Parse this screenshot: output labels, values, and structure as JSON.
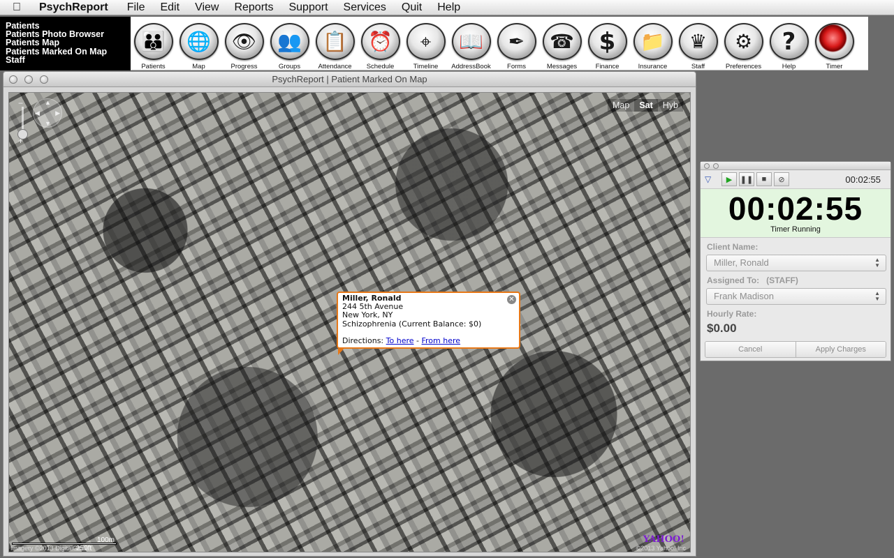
{
  "menubar": {
    "apple": "",
    "app_name": "PsychReport",
    "items": [
      "File",
      "Edit",
      "View",
      "Reports",
      "Support",
      "Services",
      "Quit",
      "Help"
    ]
  },
  "leftnav": {
    "items": [
      "Patients",
      "Patients Photo Browser",
      "Patients Map",
      "Patients Marked On Map",
      "Staff"
    ]
  },
  "toolbar": {
    "tools": [
      {
        "label": "Patients",
        "icon": "people-icon",
        "glyph": "👪"
      },
      {
        "label": "Map",
        "icon": "globe-icon",
        "glyph": "🌐"
      },
      {
        "label": "Progress",
        "icon": "eye-icon",
        "glyph": "👁"
      },
      {
        "label": "Groups",
        "icon": "group-icon",
        "glyph": "👥"
      },
      {
        "label": "Attendance",
        "icon": "clipboard-icon",
        "glyph": "📋"
      },
      {
        "label": "Schedule",
        "icon": "clock-icon",
        "glyph": "⏰"
      },
      {
        "label": "Timeline",
        "icon": "crosshair-icon",
        "glyph": "⌖"
      },
      {
        "label": "AddressBook",
        "icon": "book-icon",
        "glyph": "📖"
      },
      {
        "label": "Forms",
        "icon": "pen-icon",
        "glyph": "✒"
      },
      {
        "label": "Messages",
        "icon": "phone-icon",
        "glyph": "☎"
      },
      {
        "label": "Finance",
        "icon": "dollar-icon",
        "glyph": "$"
      },
      {
        "label": "Insurance",
        "icon": "folder-icon",
        "glyph": "📁"
      },
      {
        "label": "Staff",
        "icon": "crown-icon",
        "glyph": "♛"
      },
      {
        "label": "Preferences",
        "icon": "gears-icon",
        "glyph": "⚙"
      },
      {
        "label": "Help",
        "icon": "question-icon",
        "glyph": "?"
      },
      {
        "label": "Timer",
        "icon": "record-icon",
        "glyph": ""
      }
    ]
  },
  "mapwin": {
    "title": "PsychReport | Patient Marked On Map",
    "map_types": [
      "Map",
      "Sat",
      "Hyb"
    ],
    "active_map_type": "Sat",
    "scale_top": "100m",
    "scale_bottom": "250ft",
    "attribution": "Imagery ©2013 DigitalGlobe",
    "brand": "YAHOO!",
    "copyright": "©2013 Yahoo! Inc",
    "popup": {
      "name": "Miller, Ronald",
      "address1": "244 5th Avenue",
      "address2": "New York, NY",
      "diagnosis": "Schizophrenia (Current Balance: $0)",
      "directions_label": "Directions:",
      "to_here": "To here",
      "separator": "-",
      "from_here": "From here"
    }
  },
  "timer": {
    "small_time": "00:02:55",
    "big_time": "00:02:55",
    "status": "Timer Running",
    "client_label": "Client Name:",
    "client_value": "Miller, Ronald",
    "assigned_label": "Assigned To:   (STAFF)",
    "assigned_value": "Frank Madison",
    "rate_label": "Hourly Rate:",
    "rate_value": "$0.00",
    "cancel": "Cancel",
    "apply": "Apply Charges"
  },
  "colors": {
    "popup_border": "#e77817",
    "timer_bg": "#e3f6df",
    "play_green": "#1fa31f",
    "brand_purple": "#7d1fd0"
  }
}
